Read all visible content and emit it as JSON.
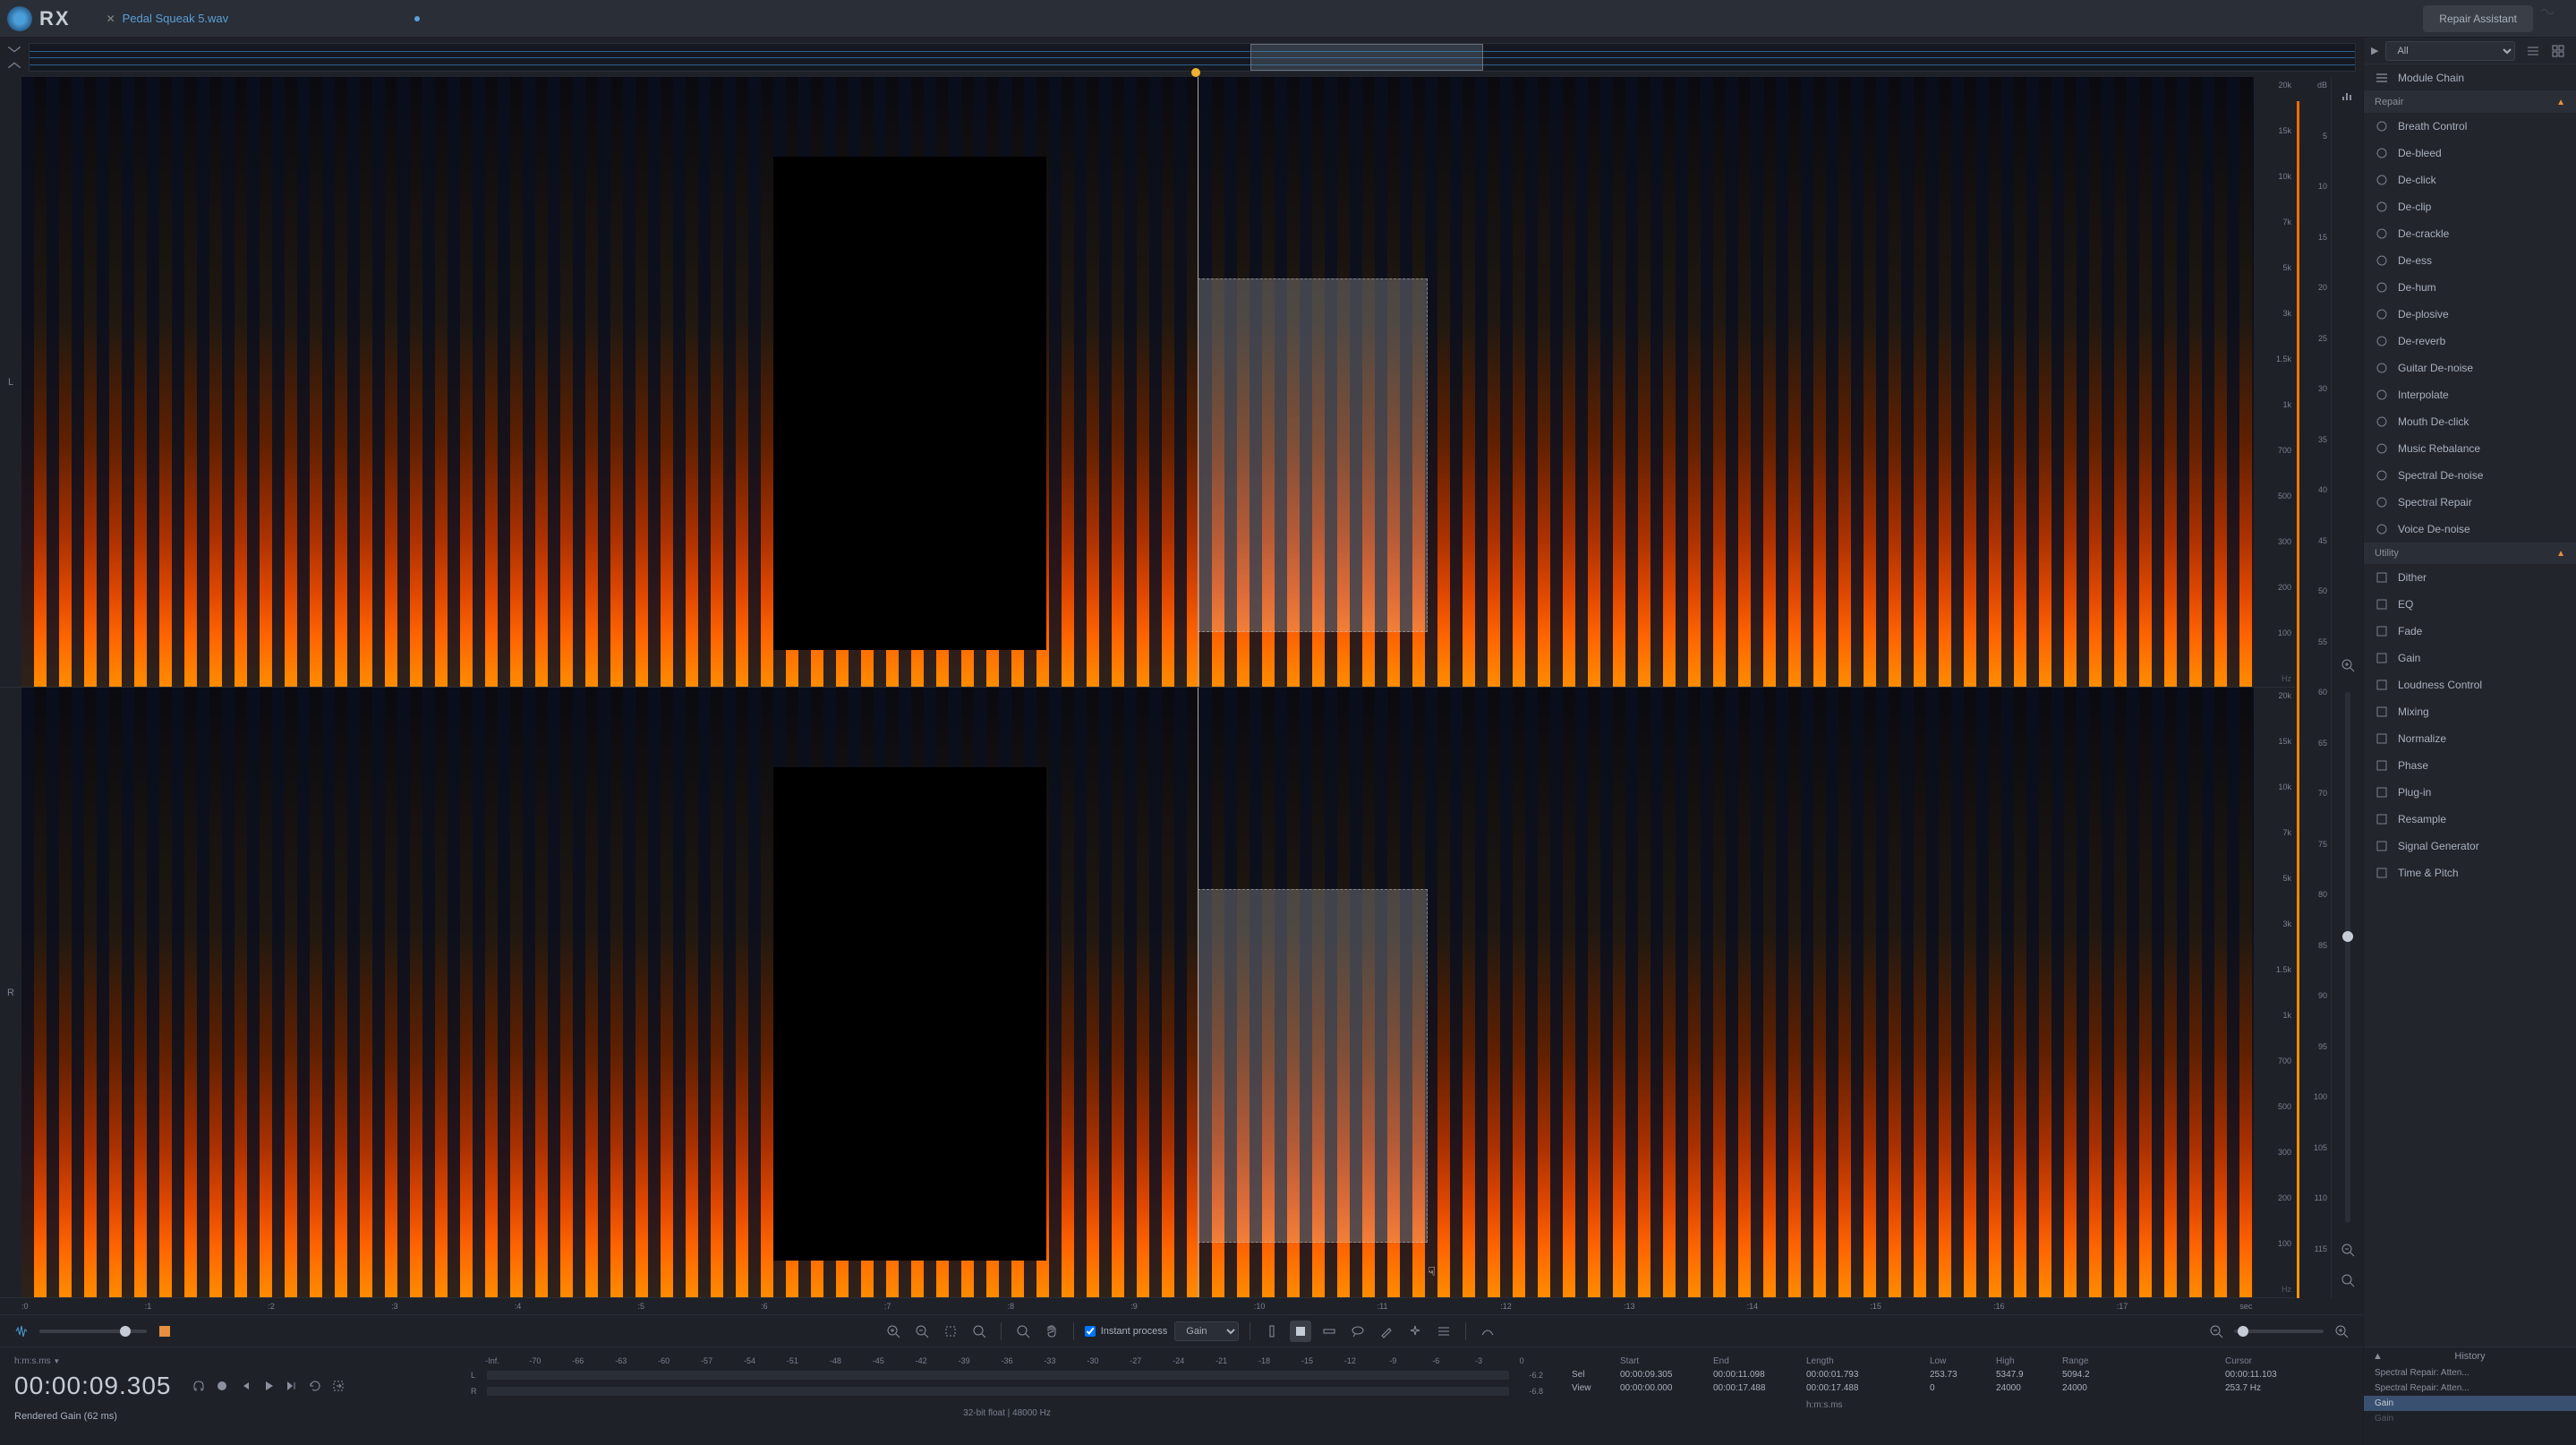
{
  "titlebar": {
    "app_name": "RX",
    "tab_name": "Pedal Squeak 5.wav",
    "repair_btn": "Repair Assistant"
  },
  "right_panel": {
    "filter": "All",
    "module_chain": "Module Chain",
    "section_repair": "Repair",
    "section_utility": "Utility",
    "repair_items": [
      "Breath Control",
      "De-bleed",
      "De-click",
      "De-clip",
      "De-crackle",
      "De-ess",
      "De-hum",
      "De-plosive",
      "De-reverb",
      "Guitar De-noise",
      "Interpolate",
      "Mouth De-click",
      "Music Rebalance",
      "Spectral De-noise",
      "Spectral Repair",
      "Voice De-noise"
    ],
    "utility_items": [
      "Dither",
      "EQ",
      "Fade",
      "Gain",
      "Loudness Control",
      "Mixing",
      "Normalize",
      "Phase",
      "Plug-in",
      "Resample",
      "Signal Generator",
      "Time & Pitch"
    ]
  },
  "freq_labels": [
    "20k",
    "15k",
    "10k",
    "7k",
    "5k",
    "3k",
    "1.5k",
    "1k",
    "700",
    "500",
    "300",
    "200",
    "100"
  ],
  "db_labels": [
    "dB",
    "5",
    "10",
    "15",
    "20",
    "25",
    "30",
    "35",
    "40",
    "45",
    "50",
    "55",
    "60",
    "65",
    "70",
    "75",
    "80",
    "85",
    "90",
    "95",
    "100",
    "105",
    "110",
    "115"
  ],
  "time_labels": [
    ":0",
    ":1",
    ":2",
    ":3",
    ":4",
    ":5",
    ":6",
    ":7",
    ":8",
    ":9",
    ":10",
    ":11",
    ":12",
    ":13",
    ":14",
    ":15",
    ":16",
    ":17",
    "sec"
  ],
  "toolbar": {
    "instant_process": "Instant process",
    "process_select": "Gain"
  },
  "info": {
    "time_format": "h:m:s.ms",
    "timecode": "00:00:09.305",
    "status": "Rendered Gain (62 ms)",
    "meter_scale": [
      "-Inf.",
      "-70",
      "-66",
      "-63",
      "-60",
      "-57",
      "-54",
      "-51",
      "-48",
      "-45",
      "-42",
      "-39",
      "-36",
      "-33",
      "-30",
      "-27",
      "-24",
      "-21",
      "-18",
      "-15",
      "-12",
      "-9",
      "-6",
      "-3",
      "0"
    ],
    "meter_L": "-6.2",
    "meter_R": "-6.8",
    "audio_format": "32-bit float | 48000 Hz",
    "sel_headers": {
      "start": "Start",
      "end": "End",
      "length": "Length"
    },
    "sel_label": "Sel",
    "view_label": "View",
    "sel_start": "00:00:09.305",
    "sel_end": "00:00:11.098",
    "sel_length": "00:00:01.793",
    "view_start": "00:00:00.000",
    "view_end": "00:00:17.488",
    "view_length": "00:00:17.488",
    "time_unit": "h:m:s.ms",
    "range_headers": {
      "low": "Low",
      "high": "High",
      "range": "Range"
    },
    "range_low_sel": "253.73",
    "range_high_sel": "5347.9",
    "range_range_sel": "5094.2",
    "range_low_view": "0",
    "range_high_view": "24000",
    "range_range_view": "24000",
    "cursor_header": "Cursor",
    "cursor_time": "00:00:11.103",
    "cursor_freq": "253.7 Hz"
  },
  "history": {
    "title": "History",
    "items": [
      {
        "label": "Spectral Repair: Atten...",
        "dim": false
      },
      {
        "label": "Spectral Repair: Atten...",
        "dim": false
      },
      {
        "label": "Gain",
        "active": true
      },
      {
        "label": "Gain",
        "dim": true
      }
    ]
  }
}
